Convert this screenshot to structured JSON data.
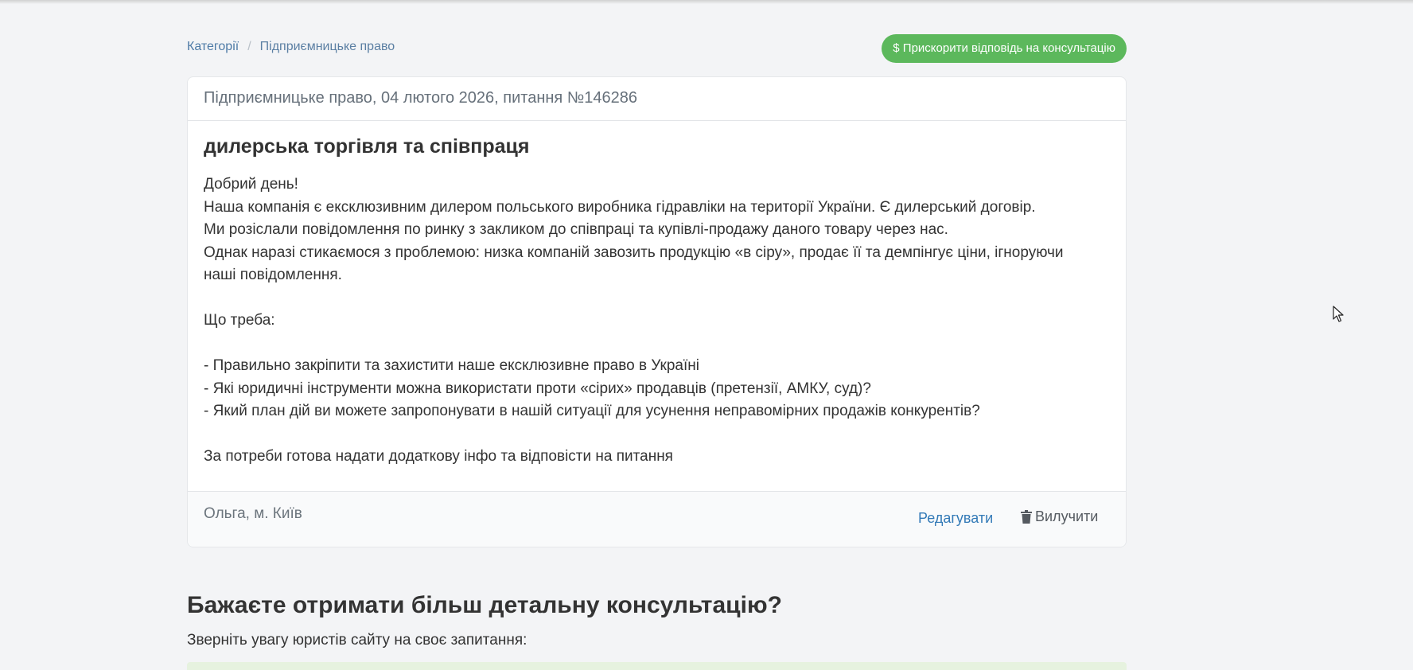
{
  "breadcrumb": {
    "items": [
      "Категорії",
      "Підприємницьке право"
    ],
    "separator": "/"
  },
  "actions": {
    "speed_up_label": "$ Прискорити відповідь на консультацію"
  },
  "question": {
    "header": "Підприємницьке право, 04 лютого 2026, питання №146286",
    "title": "дилерська торгівля та співпраця",
    "body_lines": [
      "Добрий день!",
      "Наша компанія є ексклюзивним дилером польського виробника гідравліки на території України. Є дилерський договір.",
      "Ми розіслали повідомлення по ринку з закликом до співпраці та купівлі-продажу даного товару через нас.",
      "Однак наразі стикаємося з проблемою: низка компаній завозить продукцію «в сіру», продає її та демпінгує ціни, ігноруючи",
      "наші повідомлення.",
      "",
      "Що треба:",
      "",
      "- Правильно закріпити та захистити наше ексклюзивне право в Україні",
      "- Які юридичні інструменти можна використати проти «сірих» продавців (претензії, АМКУ, суд)?",
      "- Який план дій ви можете запропонувати в нашій ситуації для усунення неправомірних продажів конкурентів?",
      "",
      "За потреби готова надати додаткову інфо та відповісти на питання"
    ],
    "author": "Ольга, м. Київ",
    "edit_label": "Редагувати",
    "delete_label": "Вилучити"
  },
  "consultation": {
    "title": "Бажаєте отримати більш детальну консультацію?",
    "subtitle": "Зверніть увагу юристів сайту на своє запитання:"
  },
  "colors": {
    "accent_green": "#5cb85c",
    "link_blue": "#337ab7",
    "page_background": "#f3f4f6"
  },
  "icons": {
    "delete": "trash-icon",
    "cursor": "mouse-cursor-icon"
  }
}
